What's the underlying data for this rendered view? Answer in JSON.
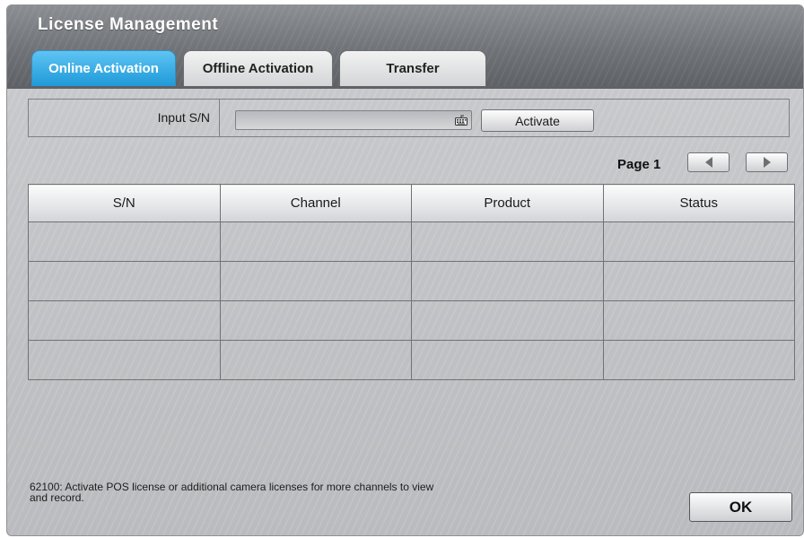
{
  "window": {
    "title": "License Management"
  },
  "tabs": [
    {
      "label": "Online Activation",
      "active": true
    },
    {
      "label": "Offline Activation",
      "active": false
    },
    {
      "label": "Transfer",
      "active": false
    }
  ],
  "input": {
    "label": "Input S/N",
    "value": "",
    "placeholder": ""
  },
  "buttons": {
    "activate": "Activate",
    "ok": "OK"
  },
  "pagination": {
    "label": "Page 1"
  },
  "table": {
    "headers": [
      "S/N",
      "Channel",
      "Product",
      "Status"
    ],
    "rows": [
      [
        "",
        "",
        "",
        ""
      ],
      [
        "",
        "",
        "",
        ""
      ],
      [
        "",
        "",
        "",
        ""
      ],
      [
        "",
        "",
        "",
        ""
      ]
    ]
  },
  "footnote": "62100: Activate POS license or additional camera licenses for more channels to view and record.",
  "icons": {
    "keyboard": "keyboard-icon",
    "prev": "arrow-left-icon",
    "next": "arrow-right-icon"
  },
  "colors": {
    "active_tab": "#1f9ad8",
    "title_bar": "#6f7276"
  }
}
